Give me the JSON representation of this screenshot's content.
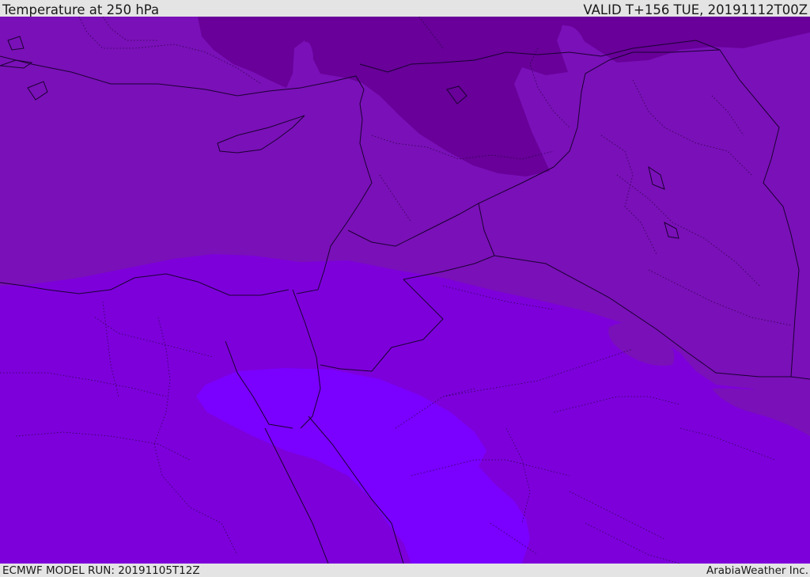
{
  "header": {
    "title": "Temperature at 250 hPa",
    "valid_time": "VALID T+156 TUE, 20191112T00Z"
  },
  "footer": {
    "model_run": "ECMWF MODEL RUN: 20191105T12Z",
    "credit": "ArabiaWeather Inc."
  },
  "colors": {
    "header_bg": "#e4e4e4",
    "temp_band_dark": "#680099",
    "temp_band_mid": "#7a10b8",
    "temp_band_light": "#7d00db",
    "temp_band_lightest": "#7a00ff",
    "border_line": "#1a0030"
  }
}
